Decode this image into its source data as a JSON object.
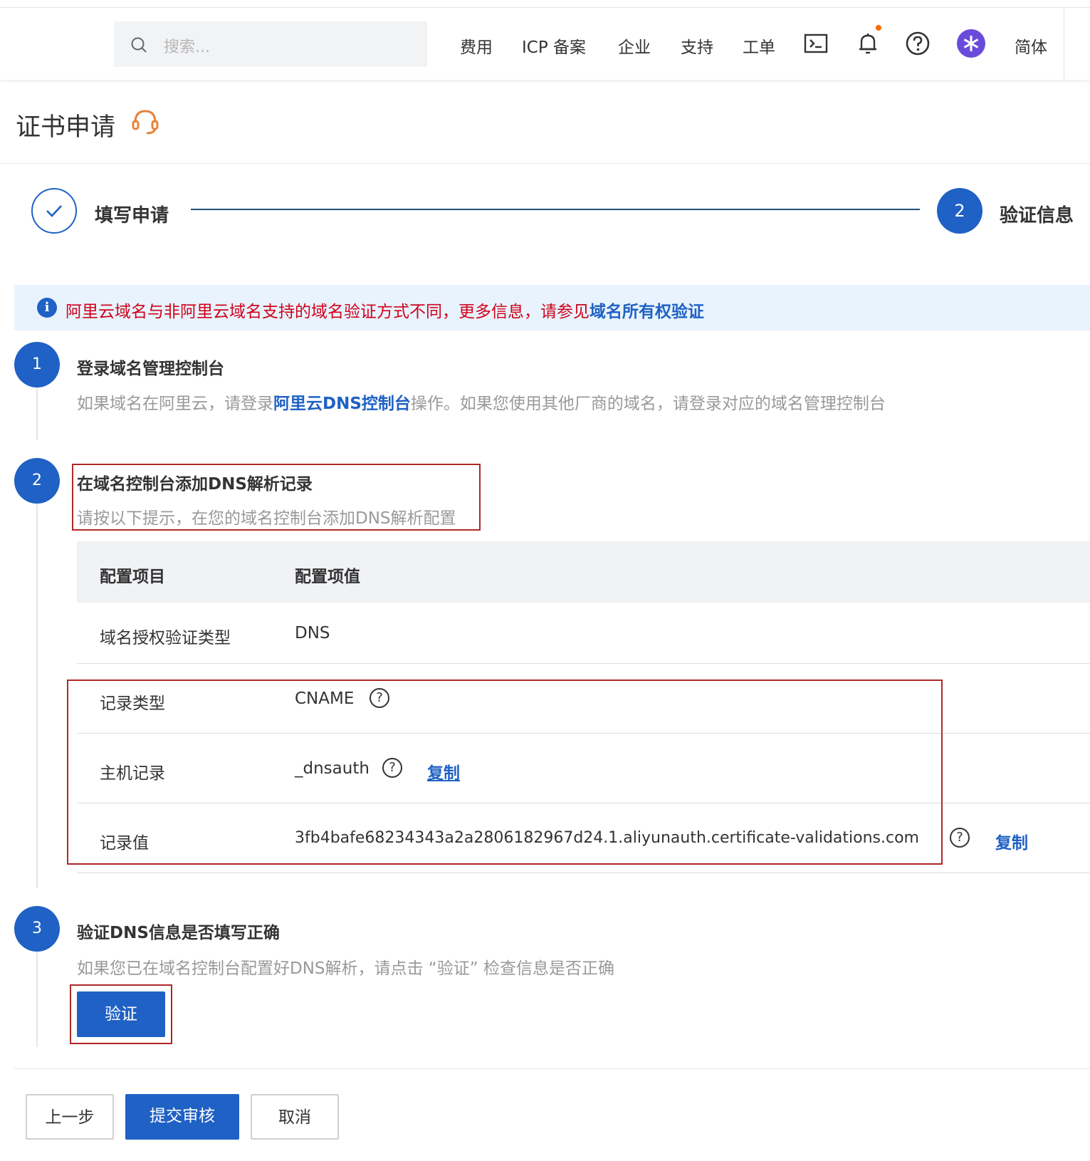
{
  "topbar": {
    "search_placeholder": "搜索...",
    "nav": [
      "费用",
      "ICP 备案",
      "企业",
      "支持",
      "工单"
    ],
    "language": "简体"
  },
  "page": {
    "title": "证书申请"
  },
  "steps": {
    "step1_label": "填写申请",
    "step2_number": "2",
    "step2_label": "验证信息"
  },
  "alert": {
    "text": "阿里云域名与非阿里云域名支持的域名验证方式不同，更多信息，请参见",
    "link": "域名所有权验证"
  },
  "section1": {
    "number": "1",
    "title": "登录域名管理控制台",
    "desc_prefix": "如果域名在阿里云，请登录",
    "desc_link": "阿里云DNS控制台",
    "desc_suffix": "操作。如果您使用其他厂商的域名，请登录对应的域名管理控制台"
  },
  "section2": {
    "number": "2",
    "title": "在域名控制台添加DNS解析记录",
    "desc": "请按以下提示，在您的域名控制台添加DNS解析配置"
  },
  "table": {
    "headers": [
      "配置项目",
      "配置项值"
    ],
    "rows": [
      {
        "key": "域名授权验证类型",
        "value": "DNS"
      },
      {
        "key": "记录类型",
        "value": "CNAME"
      },
      {
        "key": "主机记录",
        "value": "_dnsauth",
        "copy": "复制"
      },
      {
        "key": "记录值",
        "value": "3fb4bafe68234343a2a2806182967d24.1.aliyunauth.certificate-validations.com",
        "copy": "复制"
      }
    ]
  },
  "section3": {
    "number": "3",
    "title": "验证DNS信息是否填写正确",
    "desc": "如果您已在域名控制台配置好DNS解析，请点击 “验证” 检查信息是否正确",
    "verify_button": "验证"
  },
  "footer": {
    "prev": "上一步",
    "submit": "提交审核",
    "cancel": "取消"
  },
  "colors": {
    "primary": "#1f61c4",
    "alert_text": "#d0021b",
    "highlight_box": "#b0282a"
  }
}
